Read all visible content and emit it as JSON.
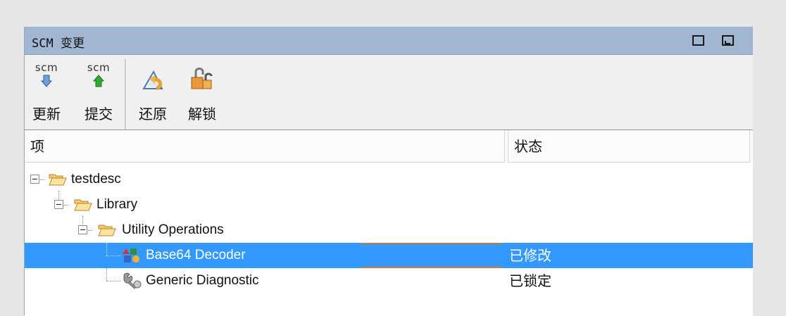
{
  "panel": {
    "title": "SCM 变更",
    "window_buttons": [
      "maximize-icon",
      "restore-icon"
    ]
  },
  "toolbar": {
    "update": {
      "caption": "scm",
      "label": "更新",
      "icon": "scm-down-arrow-icon"
    },
    "commit": {
      "caption": "scm",
      "label": "提交",
      "icon": "scm-up-arrow-icon"
    },
    "revert": {
      "label": "还原",
      "icon": "revert-icon"
    },
    "unlock": {
      "label": "解锁",
      "icon": "unlock-icon"
    }
  },
  "table": {
    "columns": {
      "item": "项",
      "status": "状态"
    },
    "rows": [
      {
        "name": "testdesc",
        "status": "",
        "icon": "folder-open-icon"
      },
      {
        "name": "Library",
        "status": "",
        "icon": "folder-open-icon"
      },
      {
        "name": "Utility Operations",
        "status": "",
        "icon": "folder-open-icon"
      },
      {
        "name": "Base64 Decoder",
        "status": "已修改",
        "icon": "component-icon",
        "selected": true
      },
      {
        "name": "Generic Diagnostic",
        "status": "已锁定",
        "icon": "wrench-icon"
      }
    ]
  },
  "colors": {
    "title_bar": "#a1b6d1",
    "selection": "#3399ff",
    "background": "#e4e6e7"
  }
}
